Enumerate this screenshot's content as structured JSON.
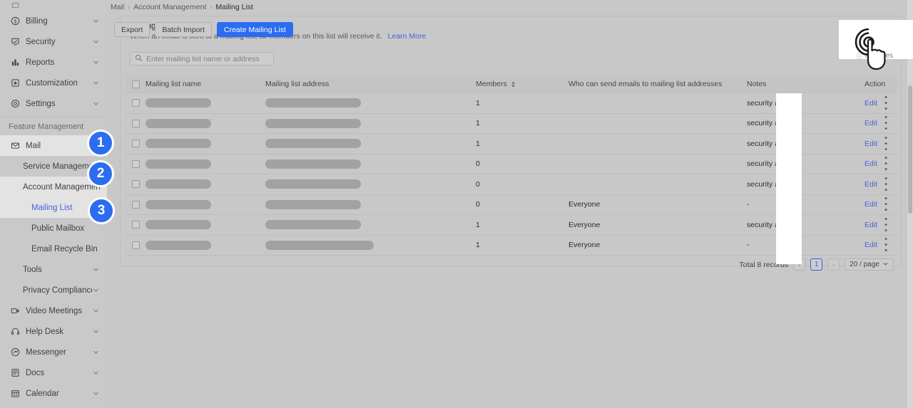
{
  "sidebar": {
    "partial_top_label": "",
    "items": [
      {
        "label": "Billing",
        "icon": "billing-icon",
        "chevron": true,
        "level": 1
      },
      {
        "label": "Security",
        "icon": "security-icon",
        "chevron": true,
        "level": 1
      },
      {
        "label": "Reports",
        "icon": "reports-icon",
        "chevron": true,
        "level": 1
      },
      {
        "label": "Customization",
        "icon": "customization-icon",
        "chevron": true,
        "level": 1
      },
      {
        "label": "Settings",
        "icon": "settings-icon",
        "chevron": true,
        "level": 1
      }
    ],
    "group_title": "Feature Management",
    "feature_items": [
      {
        "label": "Mail",
        "icon": "mail-icon",
        "chevron": false,
        "level": 1,
        "highlight": true,
        "active": false
      },
      {
        "label": "Service Management",
        "icon": "",
        "chevron": false,
        "level": 2,
        "highlight": false,
        "active": false
      },
      {
        "label": "Account Management",
        "icon": "",
        "chevron": false,
        "level": 2,
        "highlight": true,
        "active": false
      },
      {
        "label": "Mailing List",
        "icon": "",
        "chevron": false,
        "level": 3,
        "highlight": true,
        "active": true
      },
      {
        "label": "Public Mailbox",
        "icon": "",
        "chevron": false,
        "level": 3,
        "highlight": false,
        "active": false
      },
      {
        "label": "Email Recycle Bin",
        "icon": "",
        "chevron": false,
        "level": 3,
        "highlight": false,
        "active": false
      },
      {
        "label": "Tools",
        "icon": "",
        "chevron": true,
        "level": 2,
        "highlight": false,
        "active": false
      },
      {
        "label": "Privacy Compliance",
        "icon": "",
        "chevron": true,
        "level": 2,
        "highlight": false,
        "active": false
      },
      {
        "label": "Video Meetings",
        "icon": "video-icon",
        "chevron": true,
        "level": 1,
        "highlight": false,
        "active": false
      },
      {
        "label": "Help Desk",
        "icon": "headset-icon",
        "chevron": true,
        "level": 1,
        "highlight": false,
        "active": false
      },
      {
        "label": "Messenger",
        "icon": "messenger-icon",
        "chevron": true,
        "level": 1,
        "highlight": false,
        "active": false
      },
      {
        "label": "Docs",
        "icon": "docs-icon",
        "chevron": true,
        "level": 1,
        "highlight": false,
        "active": false
      },
      {
        "label": "Calendar",
        "icon": "calendar-icon",
        "chevron": true,
        "level": 1,
        "highlight": false,
        "active": false
      }
    ]
  },
  "badges": [
    {
      "number": "1"
    },
    {
      "number": "2"
    },
    {
      "number": "3"
    }
  ],
  "breadcrumb": {
    "items": [
      "Mail",
      "Account Management",
      "Mailing List"
    ],
    "separator": "›"
  },
  "header": {
    "title": "Mailing List",
    "description": "When an email is sent to a mailing list, all members on this list will receive it.",
    "learn_more": "Learn More",
    "accent_color": "#3b5ee0"
  },
  "toolbar": {
    "export_label": "Export",
    "batch_import_label": "Batch Import",
    "create_label": "Create Mailing List",
    "primary_color": "#2b6cf0",
    "set_rules_label": "Set rules"
  },
  "search": {
    "placeholder": "Enter mailing list name or address",
    "value": "",
    "icon": "search-icon"
  },
  "table": {
    "columns": [
      "Mailing list name",
      "Mailing list address",
      "Members",
      "Who can send emails to mailing list addresses",
      "Notes",
      "Action"
    ],
    "sortable_column": "Members",
    "rows": [
      {
        "name": "",
        "address": "",
        "members": "1",
        "who": "",
        "notes": "security autotest",
        "edit": "Edit"
      },
      {
        "name": "",
        "address": "",
        "members": "1",
        "who": "",
        "notes": "security autotest",
        "edit": "Edit"
      },
      {
        "name": "",
        "address": "",
        "members": "1",
        "who": "",
        "notes": "security autotest",
        "edit": "Edit"
      },
      {
        "name": "",
        "address": "",
        "members": "0",
        "who": "",
        "notes": "security autotest",
        "edit": "Edit"
      },
      {
        "name": "",
        "address": "",
        "members": "0",
        "who": "",
        "notes": "security autotest",
        "edit": "Edit"
      },
      {
        "name": "",
        "address": "",
        "members": "0",
        "who": "Everyone",
        "notes": "-",
        "edit": "Edit"
      },
      {
        "name": "",
        "address": "",
        "members": "1",
        "who": "Everyone",
        "notes": "security autotest",
        "edit": "Edit"
      },
      {
        "name": "",
        "address": "",
        "members": "1",
        "who": "Everyone",
        "notes": "-",
        "edit": "Edit"
      }
    ]
  },
  "pagination": {
    "total_label": "Total 8 records",
    "prev": "‹",
    "current_page": "1",
    "next": "›",
    "page_size": "20 / page"
  }
}
